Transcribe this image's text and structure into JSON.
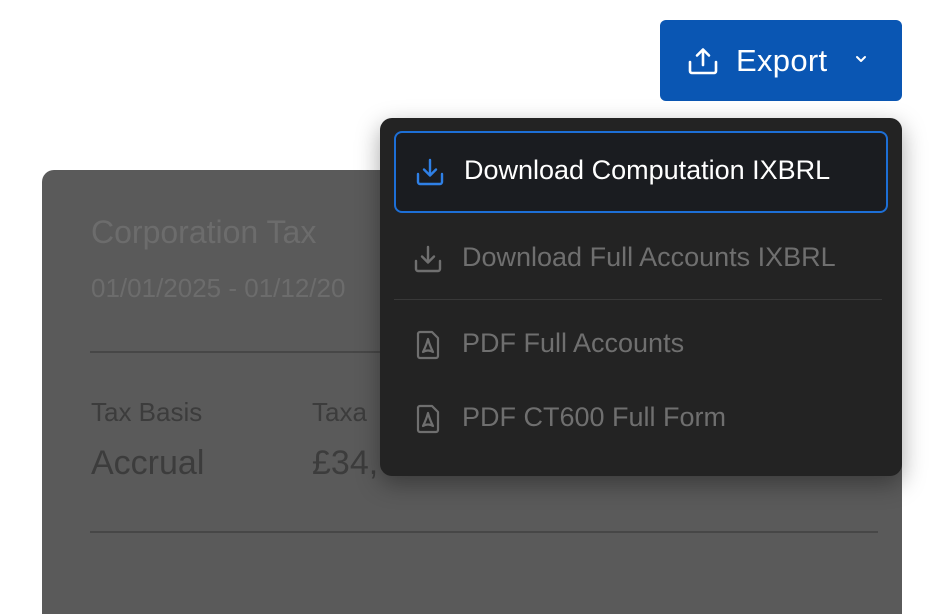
{
  "export_button": {
    "label": "Export",
    "icon": "upload-icon",
    "chevron": "chevron-down-icon",
    "color": "#0a56b3"
  },
  "card": {
    "title": "Corporation Tax",
    "period": "01/01/2025 - 01/12/20",
    "fields": [
      {
        "label": "Tax Basis",
        "value": "Accrual"
      },
      {
        "label": "Taxa",
        "value": "£34,"
      }
    ]
  },
  "menu": {
    "items": [
      {
        "label": "Download Computation IXBRL",
        "icon": "download-icon",
        "state": "focused"
      },
      {
        "label": "Download Full Accounts IXBRL",
        "icon": "download-icon",
        "state": "disabled"
      },
      {
        "label": "PDF Full Accounts",
        "icon": "pdf-icon",
        "state": "disabled"
      },
      {
        "label": "PDF CT600 Full Form",
        "icon": "pdf-icon",
        "state": "disabled"
      }
    ],
    "accent": "#1d6fd6"
  }
}
